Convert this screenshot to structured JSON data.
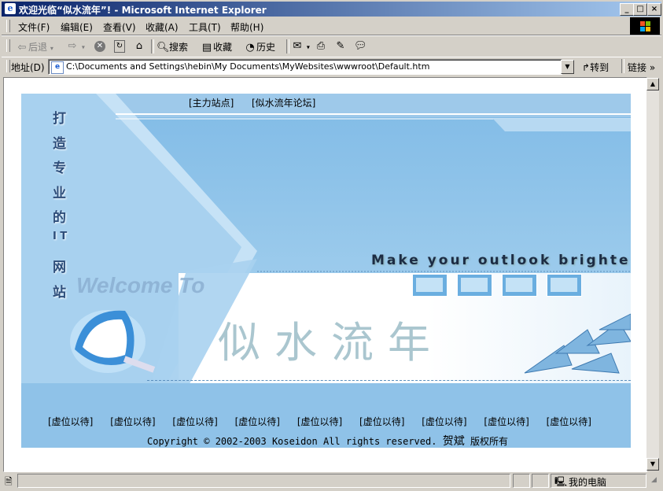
{
  "window": {
    "title": "欢迎光临“似水流年”! - Microsoft Internet Explorer",
    "buttons": {
      "min": "_",
      "max": "□",
      "close": "×"
    }
  },
  "menu": [
    "文件(F)",
    "编辑(E)",
    "查看(V)",
    "收藏(A)",
    "工具(T)",
    "帮助(H)"
  ],
  "toolbar": {
    "back": "后退",
    "search": "搜索",
    "favorites": "收藏",
    "history": "历史"
  },
  "address": {
    "label": "地址(D)",
    "value": "C:\\Documents and Settings\\hebin\\My Documents\\MyWebsites\\wwwroot\\Default.htm",
    "go": "转到",
    "links": "链接"
  },
  "page": {
    "top_links": [
      "[主力站点]",
      "[似水流年论坛]"
    ],
    "vertical_slogan": [
      "打",
      "造",
      "专",
      "业",
      "的",
      "I T",
      "网",
      "站"
    ],
    "welcome": "Welcome To",
    "tagline": "Make your outlook brighter",
    "site_name": "似水流年",
    "footer_links": [
      "[虚位以待]",
      "[虚位以待]",
      "[虚位以待]",
      "[虚位以待]",
      "[虚位以待]",
      "[虚位以待]",
      "[虚位以待]",
      "[虚位以待]",
      "[虚位以待]"
    ],
    "copyright": "Copyright © 2002-2003 Koseidon All rights reserved.",
    "author": "贺斌",
    "rights": "版权所有"
  },
  "status": {
    "zone": "我的电脑"
  },
  "colors": {
    "titlebar_start": "#0a246a",
    "titlebar_end": "#a6caf0",
    "banner": "#9ec9ea"
  }
}
